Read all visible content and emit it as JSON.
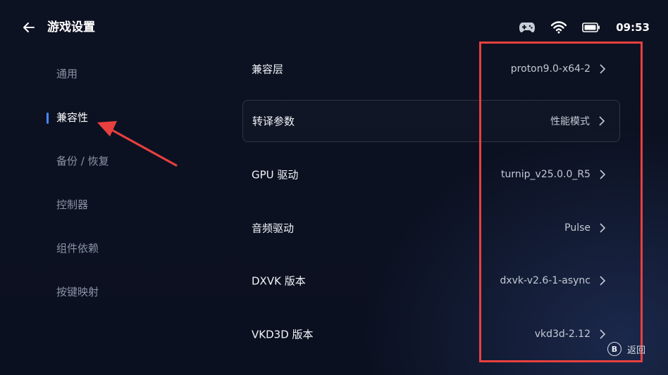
{
  "header": {
    "title": "游戏设置",
    "time": "09:53",
    "icons": [
      "gamepad-icon",
      "wifi-icon",
      "battery-icon"
    ]
  },
  "sidebar": {
    "items": [
      {
        "label": "通用",
        "active": false
      },
      {
        "label": "兼容性",
        "active": true
      },
      {
        "label": "备份 / 恢复",
        "active": false
      },
      {
        "label": "控制器",
        "active": false
      },
      {
        "label": "组件依赖",
        "active": false
      },
      {
        "label": "按键映射",
        "active": false
      }
    ]
  },
  "settings": {
    "rows": [
      {
        "label": "兼容层",
        "value": "proton9.0-x64-2"
      },
      {
        "label": "转译参数",
        "value": "性能模式",
        "focused": true
      },
      {
        "label": "GPU 驱动",
        "value": "turnip_v25.0.0_R5"
      },
      {
        "label": "音频驱动",
        "value": "Pulse"
      },
      {
        "label": "DXVK 版本",
        "value": "dxvk-v2.6-1-async"
      },
      {
        "label": "VKD3D 版本",
        "value": "vkd3d-2.12"
      }
    ]
  },
  "footer": {
    "hint_key": "B",
    "hint_label": "返回"
  },
  "colors": {
    "accent": "#4a86ff",
    "annotation": "#e8403f",
    "background": "#0b1020"
  }
}
